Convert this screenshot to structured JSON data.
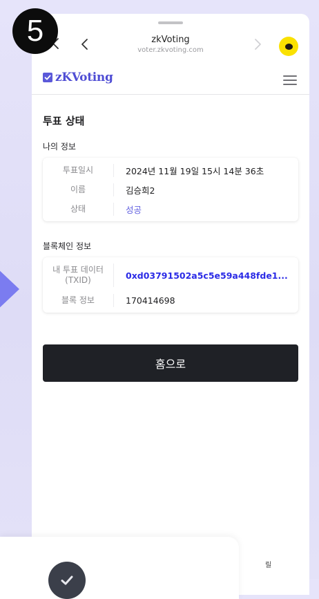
{
  "step": {
    "number": "5"
  },
  "browser": {
    "title": "zkVoting",
    "domain": "voter.zkvoting.com"
  },
  "app": {
    "logo_text": "zKVoting"
  },
  "page": {
    "title": "투표 상태"
  },
  "my_info": {
    "heading": "나의 정보",
    "rows": [
      {
        "label": "투표일시",
        "value": "2024년 11월 19일 15시 14분 36초"
      },
      {
        "label": "이름",
        "value": "김승희2"
      },
      {
        "label": "상태",
        "value": "성공"
      }
    ]
  },
  "blockchain_info": {
    "heading": "블록체인 정보",
    "rows": [
      {
        "label_line1": "내 투표 데이터",
        "label_line2": "(TXID)",
        "value": "0xd03791502a5c5e59a448fde1..."
      },
      {
        "label": "블록 정보",
        "value": "170414698"
      }
    ]
  },
  "actions": {
    "home_button": "홈으로"
  },
  "footer": {
    "partial_text": "릴"
  },
  "colors": {
    "brand": "#5b59d9",
    "success": "#6261e0",
    "txid": "#2b2be6",
    "button_dark": "#1f2126",
    "kakao": "#fae100",
    "arrow": "#7b7cf0"
  },
  "icons": {
    "close": "close-icon",
    "back": "chevron-left-icon",
    "forward": "chevron-right-icon",
    "kakao": "kakao-icon",
    "menu": "hamburger-menu-icon",
    "check": "check-icon"
  }
}
